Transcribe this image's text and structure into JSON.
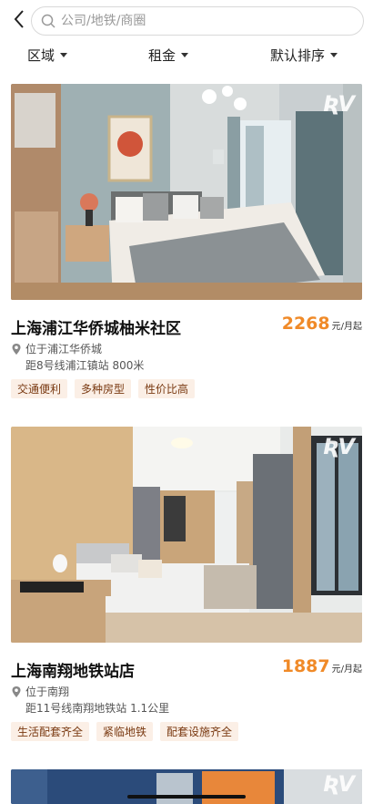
{
  "search": {
    "placeholder": "公司/地铁/商圈"
  },
  "filters": [
    {
      "label": "区域"
    },
    {
      "label": "租金"
    },
    {
      "label": "默认排序"
    }
  ],
  "listings": [
    {
      "title": "上海浦江华侨城柚米社区",
      "price": "2268",
      "price_unit": "元/月起",
      "location": "位于浦江华侨城",
      "distance": "距8号线浦江镇站 800米",
      "tags": [
        "交通便利",
        "多种房型",
        "性价比高"
      ]
    },
    {
      "title": "上海南翔地铁站店",
      "price": "1887",
      "price_unit": "元/月起",
      "location": "位于南翔",
      "distance": "距11号线南翔地铁站 1.1公里",
      "tags": [
        "生活配套齐全",
        "紧临地铁",
        "配套设施齐全"
      ]
    }
  ],
  "colors": {
    "accent": "#f08a28",
    "tag_bg": "#fbefe6",
    "tag_text": "#7a3a12"
  },
  "icons": {
    "back": "chevron-left-icon",
    "search": "search-icon",
    "location": "location-pin-icon",
    "watermark": "brand-watermark-icon"
  }
}
